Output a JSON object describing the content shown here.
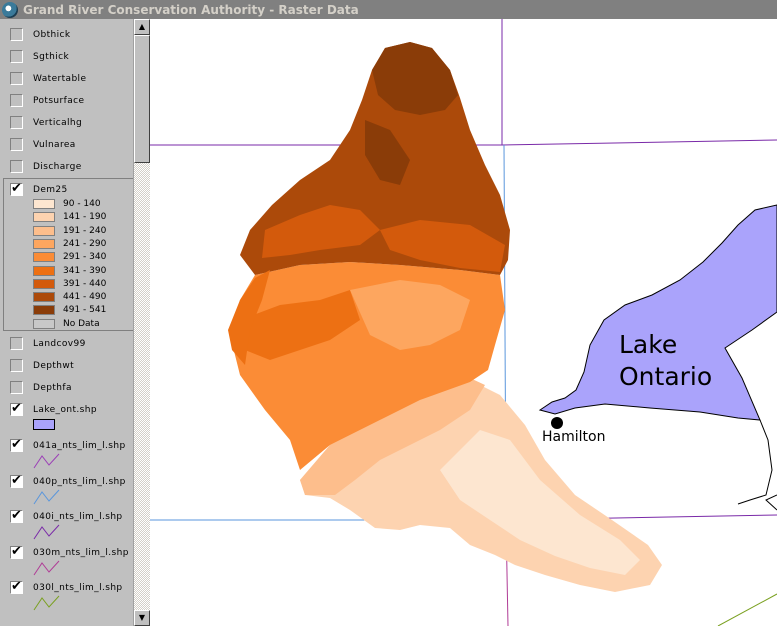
{
  "window": {
    "title": "Grand River Conservation Authority - Raster Data"
  },
  "toc": {
    "layers_top": [
      {
        "name": "Obthick",
        "checked": false
      },
      {
        "name": "Sgthick",
        "checked": false
      },
      {
        "name": "Watertable",
        "checked": false
      },
      {
        "name": "Potsurface",
        "checked": false
      },
      {
        "name": "Verticalhg",
        "checked": false
      },
      {
        "name": "Vulnarea",
        "checked": false
      },
      {
        "name": "Discharge",
        "checked": false
      }
    ],
    "dem": {
      "name": "Dem25",
      "checked": true,
      "classes": [
        {
          "label": "90 - 140",
          "color": "#fde6d0"
        },
        {
          "label": "141 - 190",
          "color": "#fdd3b0"
        },
        {
          "label": "191 - 240",
          "color": "#fdbe8c"
        },
        {
          "label": "241 - 290",
          "color": "#fda65f"
        },
        {
          "label": "291 - 340",
          "color": "#fb8c36"
        },
        {
          "label": "341 - 390",
          "color": "#ed7013"
        },
        {
          "label": "391 - 440",
          "color": "#d35a0c"
        },
        {
          "label": "441 - 490",
          "color": "#ac4a0a"
        },
        {
          "label": "491 - 541",
          "color": "#8a3c08"
        },
        {
          "label": "No Data",
          "color": "#c8c8c8"
        }
      ]
    },
    "layers_mid": [
      {
        "name": "Landcov99",
        "checked": false
      },
      {
        "name": "Depthwt",
        "checked": false
      },
      {
        "name": "Depthfa",
        "checked": false
      }
    ],
    "lake": {
      "name": "Lake_ont.shp",
      "checked": true,
      "color": "#aaa3fb"
    },
    "line_layers": [
      {
        "name": "041a_nts_lim_l.shp",
        "checked": true,
        "color": "#9b3fb6"
      },
      {
        "name": "040p_nts_lim_l.shp",
        "checked": true,
        "color": "#5a96dc"
      },
      {
        "name": "040i_nts_lim_l.shp",
        "checked": true,
        "color": "#7a2aa8"
      },
      {
        "name": "030m_nts_lim_l.shp",
        "checked": true,
        "color": "#b03c96"
      },
      {
        "name": "030l_nts_lim_l.shp",
        "checked": true,
        "color": "#7aa020"
      }
    ]
  },
  "map": {
    "lake_label_line1": "Lake",
    "lake_label_line2": "Ontario",
    "city_label": "Hamilton",
    "lake_color": "#aaa3fb"
  }
}
